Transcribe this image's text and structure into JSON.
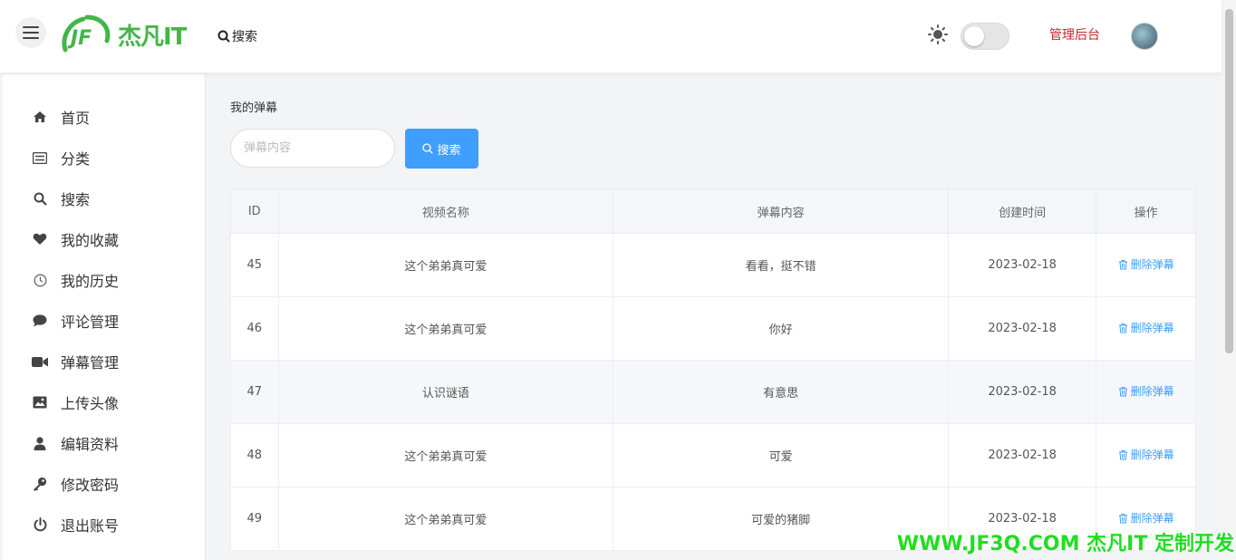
{
  "header": {
    "logo_text": "杰凡IT",
    "search_label": "搜索",
    "admin_label": "管理后台"
  },
  "sidebar": {
    "items": [
      {
        "label": "首页",
        "icon": "home-icon"
      },
      {
        "label": "分类",
        "icon": "list-icon"
      },
      {
        "label": "搜索",
        "icon": "search-icon"
      },
      {
        "label": "我的收藏",
        "icon": "heart-icon"
      },
      {
        "label": "我的历史",
        "icon": "clock-icon"
      },
      {
        "label": "评论管理",
        "icon": "comment-icon"
      },
      {
        "label": "弹幕管理",
        "icon": "video-icon"
      },
      {
        "label": "上传头像",
        "icon": "image-icon"
      },
      {
        "label": "编辑资料",
        "icon": "user-icon"
      },
      {
        "label": "修改密码",
        "icon": "key-icon"
      },
      {
        "label": "退出账号",
        "icon": "power-icon"
      }
    ]
  },
  "main": {
    "title": "我的弹幕",
    "search_placeholder": "弹幕内容",
    "search_button": "搜索",
    "table": {
      "headers": [
        "ID",
        "视频名称",
        "弹幕内容",
        "创建时间",
        "操作"
      ],
      "rows": [
        {
          "id": "45",
          "video": "这个弟弟真可爱",
          "content": "看看，挺不错",
          "time": "2023-02-18",
          "op": "删除弹幕"
        },
        {
          "id": "46",
          "video": "这个弟弟真可爱",
          "content": "你好",
          "time": "2023-02-18",
          "op": "删除弹幕"
        },
        {
          "id": "47",
          "video": "认识谜语",
          "content": "有意思",
          "time": "2023-02-18",
          "op": "删除弹幕"
        },
        {
          "id": "48",
          "video": "这个弟弟真可爱",
          "content": "可爱",
          "time": "2023-02-18",
          "op": "删除弹幕"
        },
        {
          "id": "49",
          "video": "这个弟弟真可爱",
          "content": "可爱的猪脚",
          "time": "2023-02-18",
          "op": "删除弹幕"
        }
      ]
    }
  },
  "watermark": "WWW.JF3Q.COM 杰凡IT  定制开发",
  "colors": {
    "accent": "#409eff",
    "brand": "#44b549",
    "link_red": "#c0282d"
  }
}
